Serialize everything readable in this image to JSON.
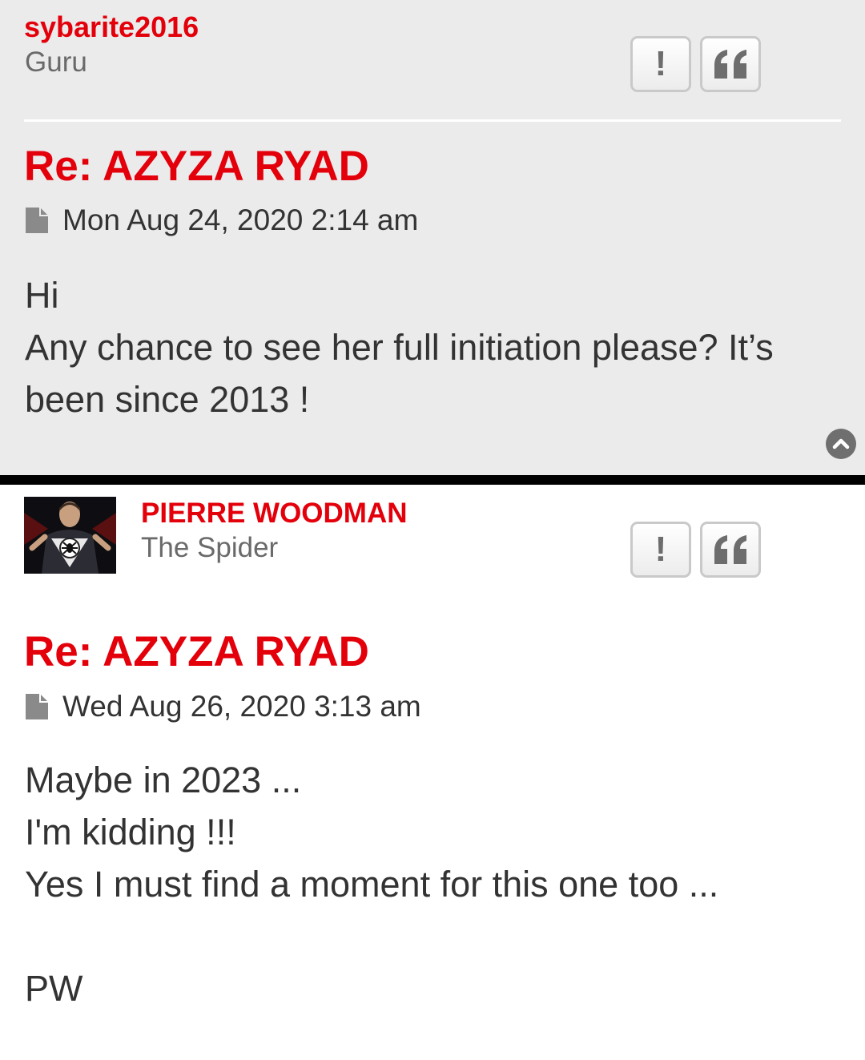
{
  "posts": [
    {
      "author": "sybarite2016",
      "rank": "Guru",
      "title": "Re: AZYZA RYAD",
      "date": "Mon Aug 24, 2020 2:14 am",
      "content_lines": [
        "Hi",
        "Any chance to see her full initiation please? It’s",
        "been since 2013 !"
      ],
      "report_label": "!",
      "quote_icon": "quote-icon"
    },
    {
      "author": "PIERRE WOODMAN",
      "rank": "The Spider",
      "avatar_icon": "spider-hero-avatar",
      "title": "Re: AZYZA RYAD",
      "date": "Wed Aug 26, 2020 3:13 am",
      "content_lines": [
        "Maybe in 2023 ...",
        "I'm kidding !!!",
        "Yes I must find a moment for this one too ...",
        "",
        "PW"
      ],
      "report_label": "!",
      "quote_icon": "quote-icon"
    }
  ],
  "colors": {
    "accent": "#e3000b",
    "post_bg_alt": "#ebebeb",
    "text": "#333333",
    "rank": "#6a6a6a"
  },
  "icons": {
    "post_icon": "document-icon",
    "back_to_top": "chevron-up-circle-icon"
  }
}
